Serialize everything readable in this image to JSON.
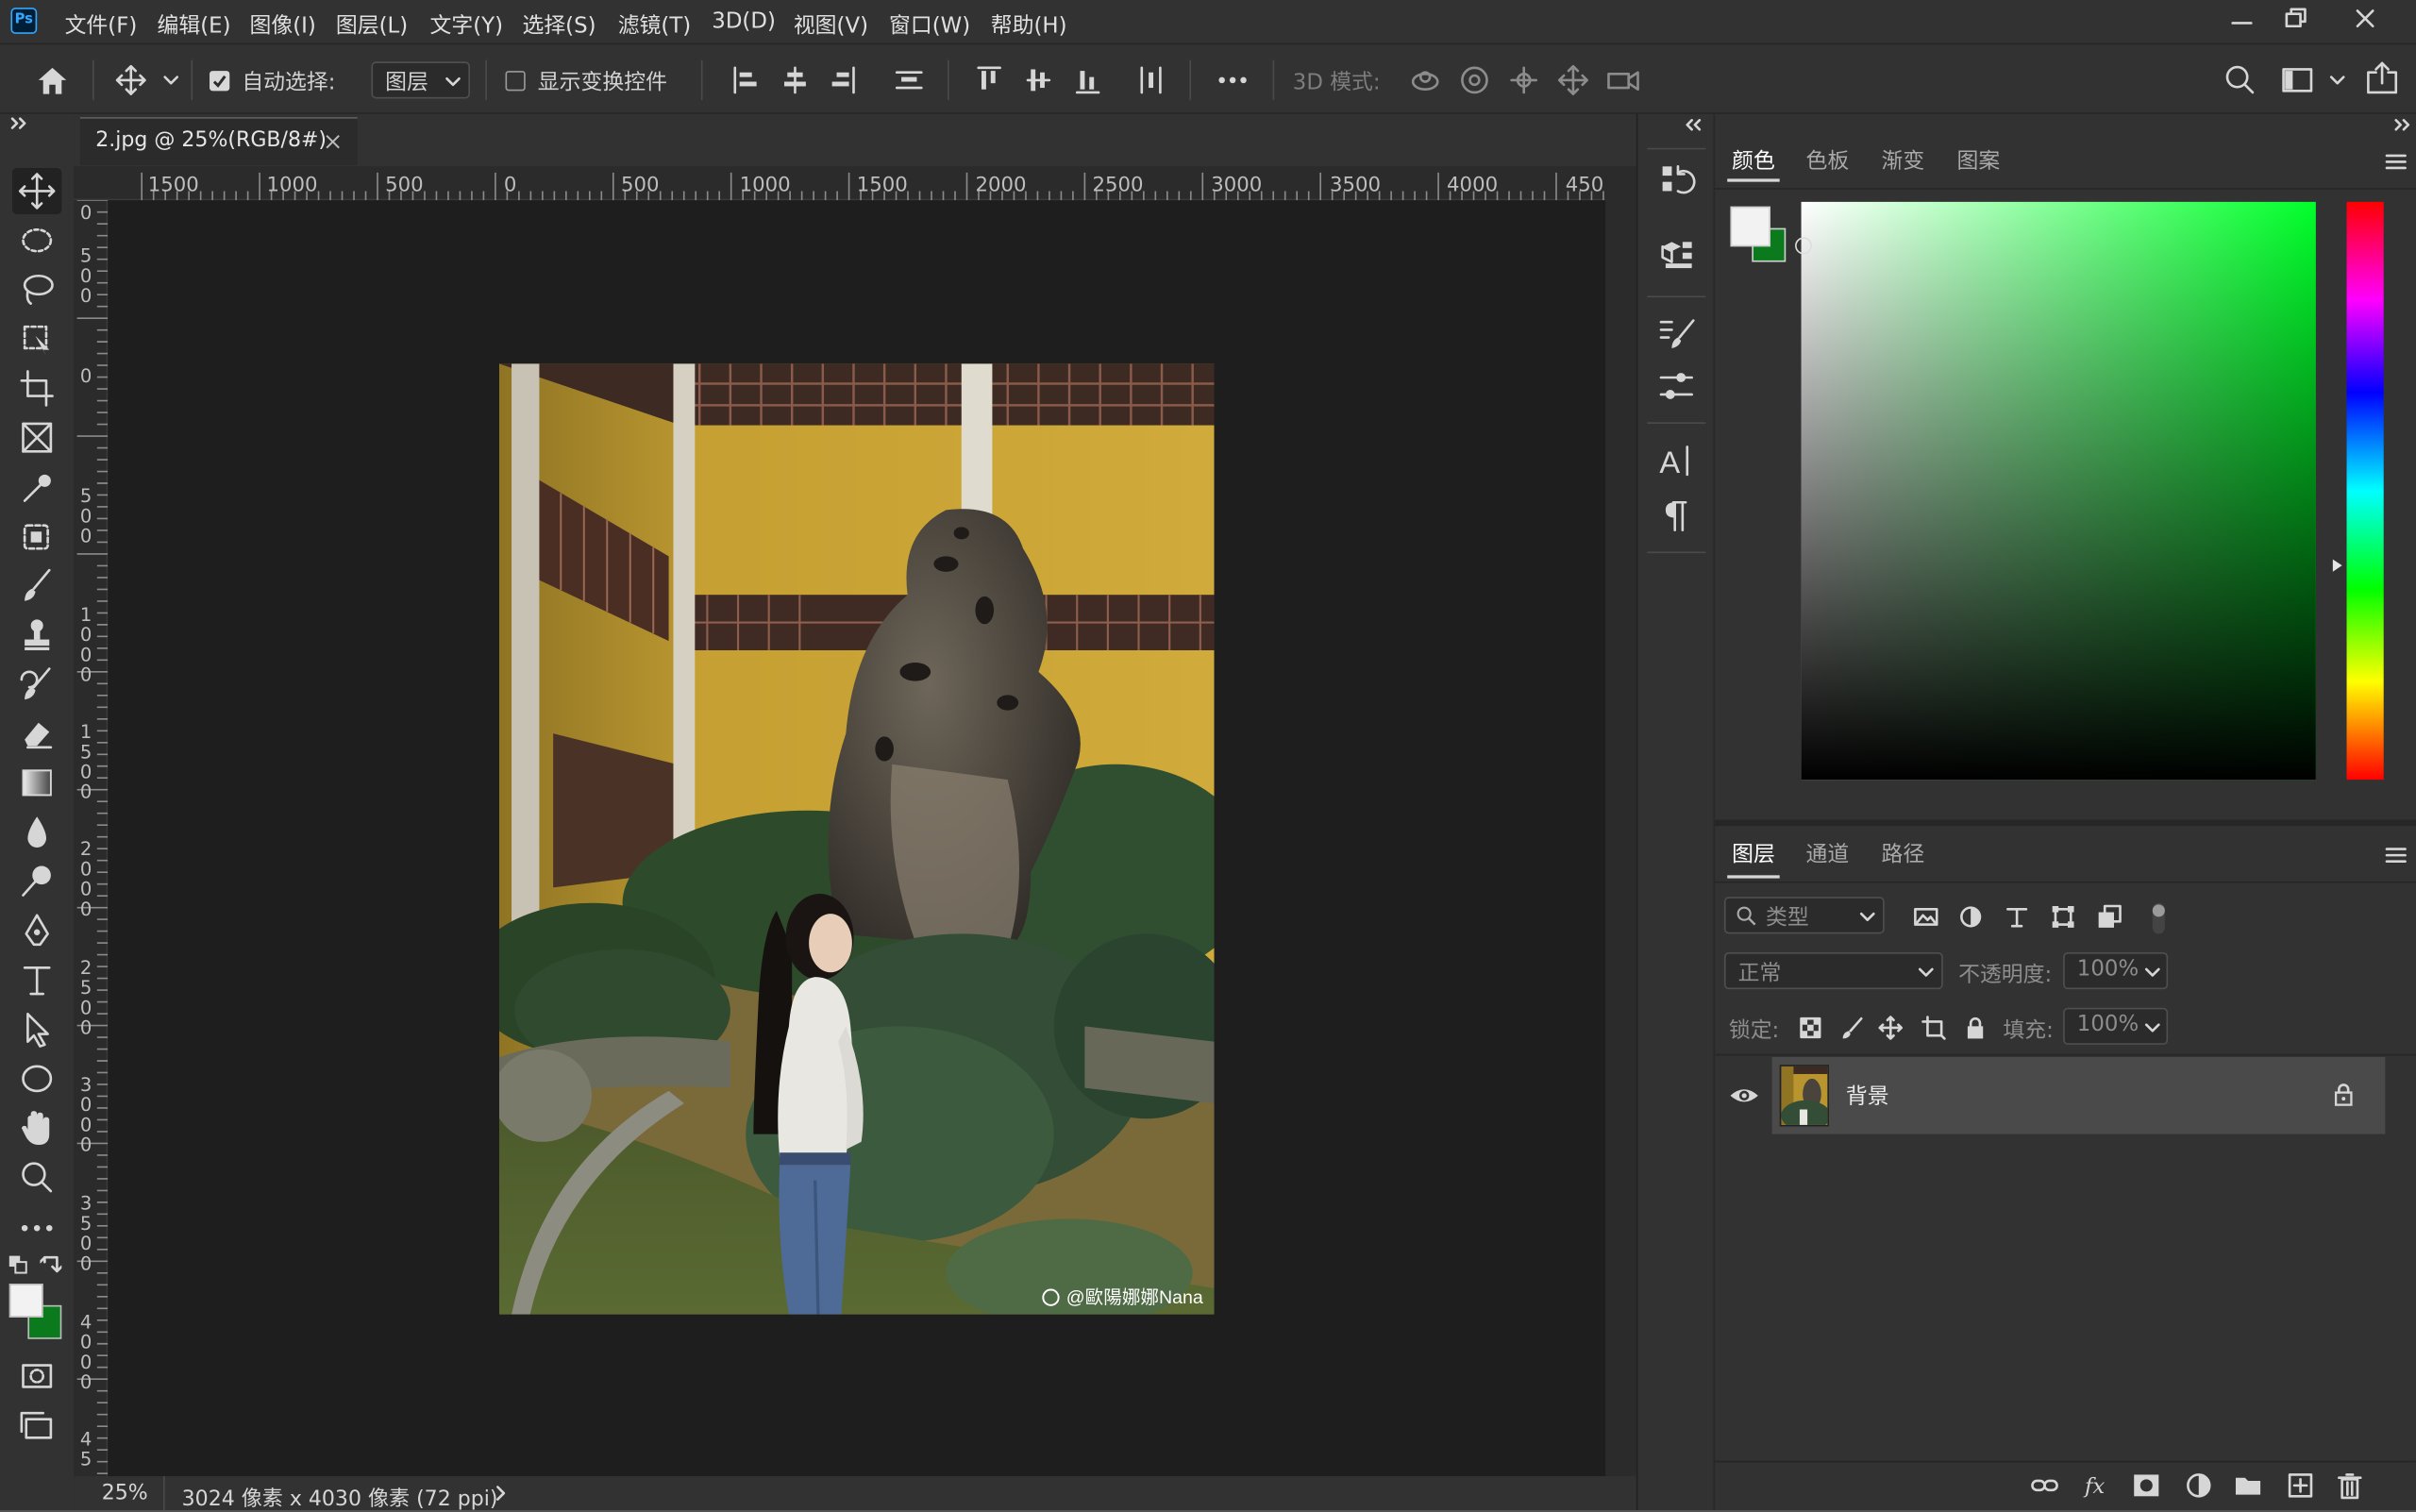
{
  "app": {
    "logo": "Ps",
    "name": "Adobe Photoshop"
  },
  "menubar": {
    "items": [
      "文件(F)",
      "编辑(E)",
      "图像(I)",
      "图层(L)",
      "文字(Y)",
      "选择(S)",
      "滤镜(T)",
      "3D(D)",
      "视图(V)",
      "窗口(W)",
      "帮助(H)"
    ]
  },
  "options": {
    "auto_select_label": "自动选择:",
    "auto_select_checked": true,
    "auto_select_target": "图层",
    "show_transform_label": "显示变换控件",
    "show_transform_checked": false,
    "mode_3d_label": "3D 模式:"
  },
  "document": {
    "tab_title": "2.jpg @ 25%(RGB/8#)",
    "zoom": "25%",
    "info": "3024 像素 x 4030 像素 (72 ppi)",
    "watermark": "@歐陽娜娜Nana"
  },
  "rulers": {
    "horizontal": [
      "1500",
      "1000",
      "500",
      "0",
      "500",
      "1000",
      "1500",
      "2000",
      "2500",
      "3000",
      "3500",
      "4000",
      "450"
    ],
    "vertical": [
      "0",
      "500",
      "0",
      "500",
      "1000",
      "1500",
      "2000",
      "2500",
      "3000",
      "3500",
      "4000",
      "45"
    ]
  },
  "color_panel": {
    "tabs": [
      "颜色",
      "色板",
      "渐变",
      "图案"
    ],
    "active_tab": "颜色",
    "foreground": "#f2f2f2",
    "background": "#0b7a1c",
    "hue_color": "#00ff2a"
  },
  "layers_panel": {
    "tabs": [
      "图层",
      "通道",
      "路径"
    ],
    "active_tab": "图层",
    "filter_placeholder": "类型",
    "blend_mode": "正常",
    "opacity_label": "不透明度:",
    "opacity": "100%",
    "lock_label": "锁定:",
    "fill_label": "填充:",
    "fill": "100%",
    "layers": [
      {
        "name": "背景",
        "visible": true,
        "locked": true
      }
    ]
  },
  "icons": [
    "home-icon",
    "move-icon",
    "search-icon",
    "workspace-icon",
    "share-icon",
    "eye-icon",
    "lock-icon"
  ]
}
